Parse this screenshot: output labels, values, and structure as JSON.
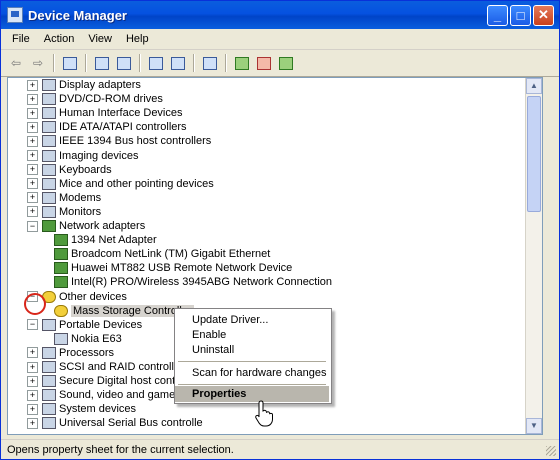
{
  "window": {
    "title": "Device Manager"
  },
  "menu": [
    "File",
    "Action",
    "View",
    "Help"
  ],
  "toolbar": {
    "icons": [
      "back-arrow",
      "forward-arrow",
      "console-tree",
      "properties",
      "print",
      "help",
      "scan",
      "update-driver",
      "disable",
      "uninstall"
    ]
  },
  "tree": {
    "items": [
      {
        "label": "Display adapters",
        "icon": "display-icon",
        "expander": "+",
        "level": 0
      },
      {
        "label": "DVD/CD-ROM drives",
        "icon": "dvd-icon",
        "expander": "+",
        "level": 0
      },
      {
        "label": "Human Interface Devices",
        "icon": "hid-icon",
        "expander": "+",
        "level": 0
      },
      {
        "label": "IDE ATA/ATAPI controllers",
        "icon": "ide-icon",
        "expander": "+",
        "level": 0
      },
      {
        "label": "IEEE 1394 Bus host controllers",
        "icon": "firewire-icon",
        "expander": "+",
        "level": 0
      },
      {
        "label": "Imaging devices",
        "icon": "camera-icon",
        "expander": "+",
        "level": 0
      },
      {
        "label": "Keyboards",
        "icon": "keyboard-icon",
        "expander": "+",
        "level": 0
      },
      {
        "label": "Mice and other pointing devices",
        "icon": "mouse-icon",
        "expander": "+",
        "level": 0
      },
      {
        "label": "Modems",
        "icon": "modem-icon",
        "expander": "+",
        "level": 0
      },
      {
        "label": "Monitors",
        "icon": "monitor-icon",
        "expander": "+",
        "level": 0
      },
      {
        "label": "Network adapters",
        "icon": "network-icon",
        "expander": "−",
        "level": 0
      },
      {
        "label": "1394 Net Adapter",
        "icon": "network-card-icon",
        "expander": "",
        "level": 1
      },
      {
        "label": "Broadcom NetLink (TM) Gigabit Ethernet",
        "icon": "network-card-icon",
        "expander": "",
        "level": 1
      },
      {
        "label": "Huawei MT882 USB Remote Network Device",
        "icon": "network-card-icon",
        "expander": "",
        "level": 1
      },
      {
        "label": "Intel(R) PRO/Wireless 3945ABG Network Connection",
        "icon": "network-card-icon",
        "expander": "",
        "level": 1
      },
      {
        "label": "Other devices",
        "icon": "question-icon",
        "expander": "−",
        "level": 0
      },
      {
        "label": "Mass Storage Controller",
        "icon": "warning-icon",
        "expander": "",
        "level": 1
      },
      {
        "label": "Portable Devices",
        "icon": "portable-icon",
        "expander": "−",
        "level": 0
      },
      {
        "label": "Nokia E63",
        "icon": "phone-icon",
        "expander": "",
        "level": 1
      },
      {
        "label": "Processors",
        "icon": "cpu-icon",
        "expander": "+",
        "level": 0
      },
      {
        "label": "SCSI and RAID controllers",
        "icon": "scsi-icon",
        "expander": "+",
        "level": 0
      },
      {
        "label": "Secure Digital host controlle",
        "icon": "sd-icon",
        "expander": "+",
        "level": 0
      },
      {
        "label": "Sound, video and game contro",
        "icon": "sound-icon",
        "expander": "+",
        "level": 0
      },
      {
        "label": "System devices",
        "icon": "system-icon",
        "expander": "+",
        "level": 0
      },
      {
        "label": "Universal Serial Bus controlle",
        "icon": "usb-icon",
        "expander": "+",
        "level": 0
      }
    ]
  },
  "context_menu": {
    "items": [
      {
        "label": "Update Driver..."
      },
      {
        "label": "Enable"
      },
      {
        "label": "Uninstall"
      },
      {
        "label": "Scan for hardware changes"
      },
      {
        "label": "Properties",
        "selected": true
      }
    ]
  },
  "status": "Opens property sheet for the current selection."
}
